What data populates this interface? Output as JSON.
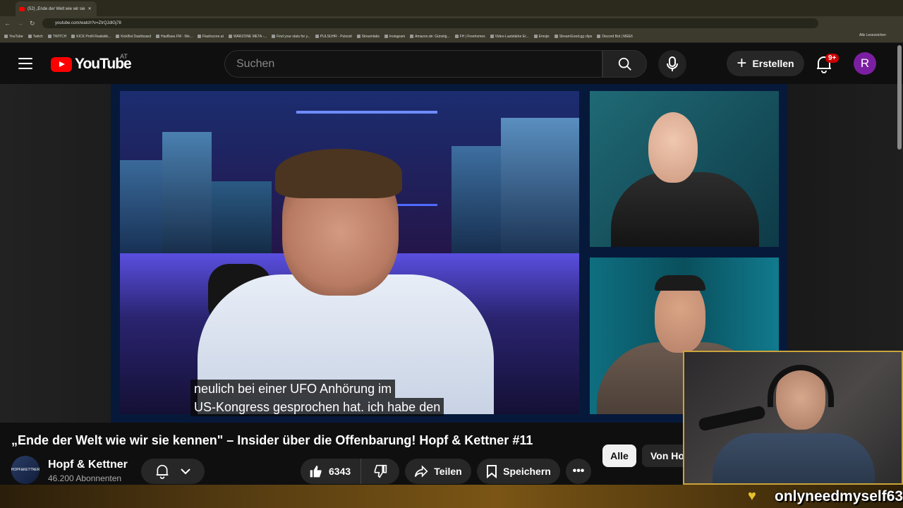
{
  "browser": {
    "tab_title": "(52) „Ende der Welt wie wir sie",
    "url": "youtube.com/watch?v=ZtrQJdlGj78",
    "bookmarks": [
      "YouTube",
      "Twitch",
      "TWITCH",
      "KICK Profil Realistik...",
      "KickBot Dashboard",
      "HasBase.FM - We...",
      "Flashscore.at",
      "WARZONE META -...",
      "Find your stats for y...",
      "PULSUHR - Pulsoid",
      "Streamlabs",
      "Instagram",
      "Amazon.de: Günstig...",
      "FH | Freehomes",
      "Video-Lautstärke Er...",
      "Emojis",
      "StreamGood.gg clips",
      "Discord Bot | MEE6"
    ],
    "all_bookmarks": "Alle Lesezeichen"
  },
  "youtube": {
    "logo_text": "YouTube",
    "country": "AT",
    "search_placeholder": "Suchen",
    "create_label": "Erstellen",
    "notification_badge": "9+",
    "avatar_letter": "R"
  },
  "video": {
    "subtitle_line1": "neulich bei einer UFO Anhörung im",
    "subtitle_line2": "US-Kongress gesprochen hat. ich habe den",
    "title": "„Ende der Welt wie wir sie kennen\" – Insider über die Offenbarung! Hopf & Kettner #11",
    "channel_name": "Hopf & Kettner",
    "channel_avatar_text": "HOPF&KETTNER",
    "subscribers": "46.200 Abonnenten",
    "likes": "6343",
    "share_label": "Teilen",
    "save_label": "Speichern",
    "more_label": "•••"
  },
  "chips": {
    "all": "Alle",
    "from": "Von Ho"
  },
  "overlay": {
    "stream_name": "onlyneedmyself63"
  },
  "colors": {
    "brand": "#ff0000",
    "gold": "#caa53b",
    "avatar": "#7b1fa2"
  }
}
